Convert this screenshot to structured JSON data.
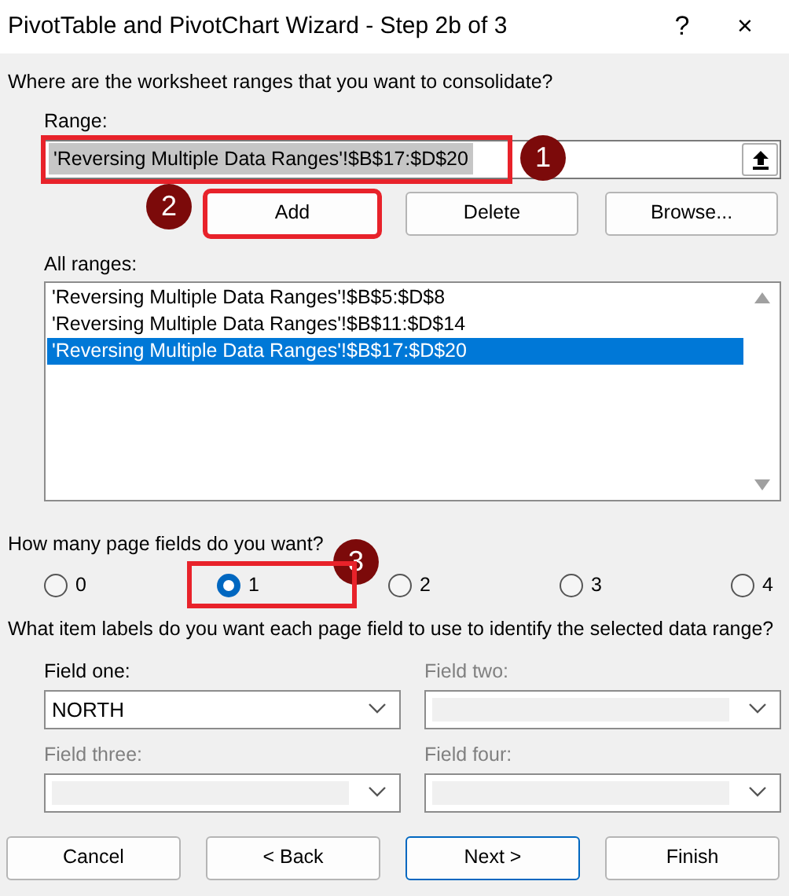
{
  "window": {
    "title": "PivotTable and PivotChart Wizard - Step 2b of 3",
    "help": "?",
    "close": "×"
  },
  "question": "Where are the worksheet ranges that you want to consolidate?",
  "range": {
    "label": "Range:",
    "value": "'Reversing Multiple Data Ranges'!$B$17:$D$20",
    "text_selected": true,
    "highlighted": true,
    "callout": "1"
  },
  "range_buttons": [
    {
      "label": "Add",
      "highlighted": true,
      "callout": "2"
    },
    {
      "label": "Delete",
      "highlighted": false
    },
    {
      "label": "Browse...",
      "highlighted": false
    }
  ],
  "all_ranges": {
    "label": "All ranges:",
    "items": [
      {
        "text": "'Reversing Multiple Data Ranges'!$B$5:$D$8",
        "selected": false
      },
      {
        "text": "'Reversing Multiple Data Ranges'!$B$11:$D$14",
        "selected": false
      },
      {
        "text": "'Reversing Multiple Data Ranges'!$B$17:$D$20",
        "selected": true
      }
    ]
  },
  "page_fields_question": "How many page fields do you want?",
  "page_field_options": [
    {
      "label": "0",
      "selected": false,
      "highlighted": false
    },
    {
      "label": "1",
      "selected": true,
      "highlighted": true,
      "callout": "3"
    },
    {
      "label": "2",
      "selected": false,
      "highlighted": false
    },
    {
      "label": "3",
      "selected": false,
      "highlighted": false
    },
    {
      "label": "4",
      "selected": false,
      "highlighted": false
    }
  ],
  "item_labels_question": "What item labels do you want each page field to use to identify the selected data range?",
  "fields": [
    {
      "label": "Field one:",
      "value": "NORTH",
      "disabled": false
    },
    {
      "label": "Field two:",
      "disabled": true
    },
    {
      "label": "Field three:",
      "disabled": true
    },
    {
      "label": "Field four:",
      "disabled": true
    }
  ],
  "buttons": [
    {
      "label": "Cancel",
      "default": false
    },
    {
      "label": "< Back",
      "default": false
    },
    {
      "label": "Next >",
      "default": true
    },
    {
      "label": "Finish",
      "default": false
    }
  ]
}
